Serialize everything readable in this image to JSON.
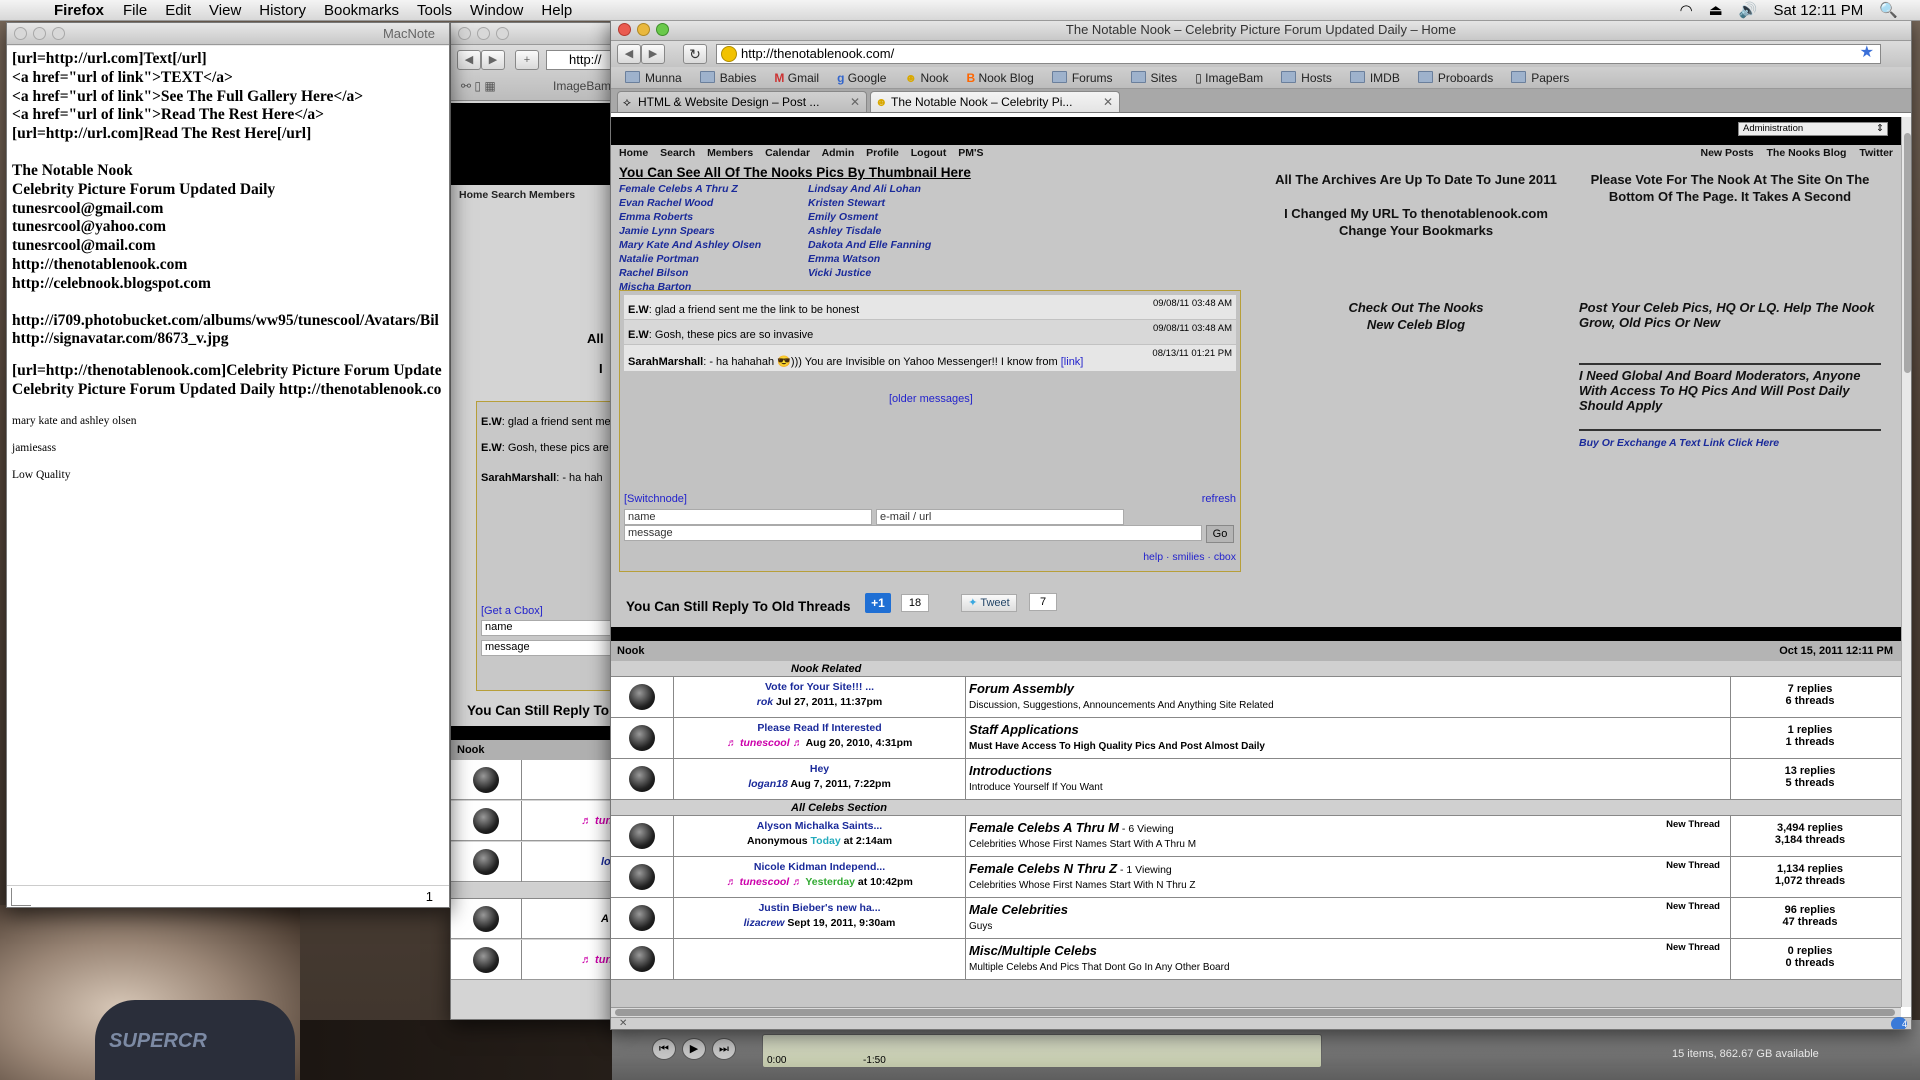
{
  "menubar": {
    "app": "Firefox",
    "items": [
      "File",
      "Edit",
      "View",
      "History",
      "Bookmarks",
      "Tools",
      "Window",
      "Help"
    ],
    "clock": "Sat 12:11 PM"
  },
  "macnote": {
    "title": "MacNote",
    "lines": [
      "[url=http://url.com]Text[/url]",
      "<a href=\"url of link\">TEXT</a>",
      "<a href=\"url of link\">See The Full Gallery Here</a>",
      "<a href=\"url of link\">Read The Rest Here</a>",
      "[url=http://url.com]Read The Rest Here[/url]"
    ],
    "lines2": [
      "The Notable Nook",
      "Celebrity Picture Forum Updated Daily",
      "tunesrcool@gmail.com",
      "tunesrcool@yahoo.com",
      "tunesrcool@mail.com",
      "http://thenotablenook.com",
      "http://celebnook.blogspot.com"
    ],
    "lines3": [
      "http://i709.photobucket.com/albums/ww95/tunescool/Avatars/Bil",
      "http://signavatar.com/8673_v.jpg"
    ],
    "lines4": [
      "[url=http://thenotablenook.com]Celebrity Picture Forum Update",
      "Celebrity Picture Forum Updated Daily http://thenotablenook.co"
    ],
    "small": [
      "mary kate and ashley olsen",
      "jamiesass",
      "Low Quality"
    ],
    "page": "1"
  },
  "win2": {
    "url": "http://",
    "imagebam": "ImageBam",
    "nav": "Home   Search   Members",
    "all": "All",
    "i": "I",
    "msgs": [
      {
        "u": "E.W",
        "t": ": glad a friend sent me"
      },
      {
        "u": "E.W",
        "t": ": Gosh, these pics are"
      },
      {
        "u": "SarahMarshall",
        "t": ": - ha hah"
      }
    ],
    "getcbox": "[Get a Cbox]",
    "name": "name",
    "message": "message",
    "reply": "You Can Still Reply To",
    "nook": "Nook",
    "users": [
      "♬ tun",
      "lo",
      "A",
      "♬ tun"
    ]
  },
  "firefox": {
    "title": "The Notable Nook – Celebrity Picture Forum Updated Daily – Home",
    "url": "http://thenotablenook.com/",
    "bookmarks": [
      "Munna",
      "Babies",
      "Gmail",
      "Google",
      "Nook",
      "Nook Blog",
      "Forums",
      "Sites",
      "ImageBam",
      "Hosts",
      "IMDB",
      "Proboards",
      "Papers"
    ],
    "tabs": [
      {
        "label": "HTML & Website Design – Post ..."
      },
      {
        "label": "The Notable Nook – Celebrity Pi..."
      }
    ]
  },
  "page": {
    "admin": "Administration",
    "menu": [
      "Home",
      "Search",
      "Members",
      "Calendar",
      "Admin",
      "Profile",
      "Logout",
      "PM'S"
    ],
    "menu_right": [
      "New Posts",
      "The Nooks Blog",
      "Twitter"
    ],
    "thumb_title": "You Can See All Of The Nooks Pics By Thumbnail Here",
    "celebs_left": [
      "Female Celebs A Thru Z",
      "Evan Rachel Wood",
      "Emma Roberts",
      "Jamie Lynn Spears",
      "Mary Kate And Ashley Olsen",
      "Natalie Portman",
      "Rachel Bilson",
      "Mischa Barton"
    ],
    "celebs_right": [
      "Lindsay And Ali Lohan",
      "Kristen Stewart",
      "Emily Osment",
      "Ashley Tisdale",
      "Dakota And Elle Fanning",
      "Emma Watson",
      "Vicki Justice"
    ],
    "archives": "All The Archives Are Up To Date To June 2011",
    "changed1": "I Changed My URL To thenotablenook.com",
    "changed2": "Change Your Bookmarks",
    "vote1": "Please Vote For The Nook At The Site On The",
    "vote2": "Bottom Of The Page. It Takes A Second",
    "blog1": "Check Out The Nooks",
    "blog2": "New Celeb Blog",
    "post_pics": "Post Your Celeb Pics, HQ Or LQ. Help The Nook Grow, Old Pics Or New",
    "need_mods": "I Need Global And Board Moderators, Anyone With Access To HQ Pics And Will Post Daily Should Apply",
    "buy_link": "Buy Or Exchange A Text Link Click Here",
    "cbox": {
      "messages": [
        {
          "ts": "09/08/11 03:48 AM",
          "user": "E.W",
          "text": ": glad a friend sent me the link to be honest"
        },
        {
          "ts": "09/08/11 03:48 AM",
          "user": "E.W",
          "text": ": Gosh, these pics are so invasive"
        },
        {
          "ts": "08/13/11 01:21 PM",
          "user": "SarahMarshall",
          "text": ": - ha hahahah 😎))) You are Invisible on Yahoo Messenger!! I know from ",
          "link": "[link]"
        }
      ],
      "older": "[older messages]",
      "switchnode": "[Switchnode]",
      "refresh": "refresh",
      "name_ph": "name",
      "email_ph": "e-mail / url",
      "message_ph": "message",
      "go": "Go",
      "help": "help · smilies · cbox"
    },
    "old_threads": "You Can Still Reply To Old Threads",
    "gplus": "+1",
    "gplus_count": "18",
    "tweet": "Tweet",
    "tweet_count": "7",
    "forum_header": "Nook",
    "forum_date": "Oct 15, 2011 12:11 PM",
    "sections": [
      {
        "name": "Nook Related",
        "rows": [
          {
            "last_title": "Vote for Your Site!!! ...",
            "last_user": "rok",
            "last_date": " Jul 27, 2011, 11:37pm",
            "forum": "Forum Assembly",
            "viewing": "",
            "desc": "Discussion, Suggestions, Announcements And Anything Site Related",
            "new_thread": "",
            "replies": "7 replies",
            "threads": "6 threads"
          },
          {
            "last_title": "Please Read If Interested",
            "last_user": "♬ tunescool ♬",
            "last_date": " Aug 20, 2010, 4:31pm",
            "forum": "Staff Applications",
            "viewing": "",
            "desc": "Must Have Access To High Quality Pics And Post Almost Daily",
            "desc_bold": true,
            "new_thread": "",
            "replies": "1 replies",
            "threads": "1 threads"
          },
          {
            "last_title": "Hey",
            "last_user": "logan18",
            "last_date": " Aug 7, 2011, 7:22pm",
            "forum": "Introductions",
            "viewing": "",
            "desc": "Introduce Yourself If You Want",
            "new_thread": "",
            "replies": "13 replies",
            "threads": "5 threads"
          }
        ]
      },
      {
        "name": "All Celebs Section",
        "rows": [
          {
            "last_title": "Alyson Michalka Saints...",
            "last_user": "Anonymous",
            "last_day": "Today",
            "last_date": " at 2:14am",
            "forum": "Female Celebs A Thru M",
            "viewing": " - 6 Viewing",
            "desc": "Celebrities Whose First Names Start With A Thru M",
            "new_thread": "New Thread",
            "replies": "3,494 replies",
            "threads": "3,184 threads"
          },
          {
            "last_title": "Nicole Kidman Independ...",
            "last_user": "♬ tunescool ♬",
            "last_day": "Yesterday",
            "last_date": " at 10:42pm",
            "forum": "Female Celebs N Thru Z",
            "viewing": " - 1 Viewing",
            "desc": "Celebrities Whose First Names Start With N Thru Z",
            "new_thread": "New Thread",
            "replies": "1,134 replies",
            "threads": "1,072 threads"
          },
          {
            "last_title": "Justin Bieber's new ha...",
            "last_user": "lizacrew",
            "last_date": " Sept 19, 2011, 9:30am",
            "forum": "Male Celebrities",
            "viewing": "",
            "desc": "Guys",
            "new_thread": "New Thread",
            "replies": "96 replies",
            "threads": "47 threads"
          },
          {
            "last_title": "",
            "last_user": "",
            "last_date": "",
            "forum": "Misc/Multiple Celebs",
            "viewing": "",
            "desc": "Multiple Celebs And Pics That Dont Go In Any Other Board",
            "new_thread": "New Thread",
            "replies": "0 replies",
            "threads": "0 threads"
          }
        ]
      }
    ]
  },
  "itunes": {
    "time_start": "0:00",
    "time_end": "-1:50",
    "status": "15 items, 862.67 GB available"
  },
  "desktop": {
    "shirt": "SUPERCR"
  }
}
